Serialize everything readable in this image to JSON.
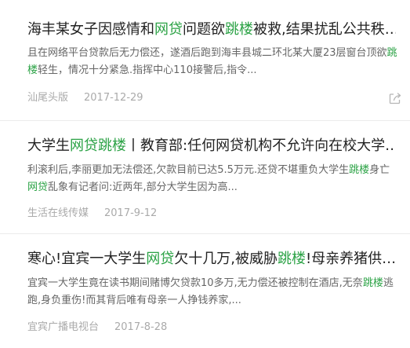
{
  "articles": [
    {
      "title": [
        {
          "t": "海丰某女子因感情和",
          "hl": false
        },
        {
          "t": "网贷",
          "hl": true
        },
        {
          "t": "问题欲",
          "hl": false
        },
        {
          "t": "跳楼",
          "hl": true
        },
        {
          "t": "被救,结果扰乱公共秩…",
          "hl": false
        }
      ],
      "summary": [
        {
          "t": "且在网络平台贷款后无力偿还，遂酒后跑到海丰县城二环北某大厦23层窗台顶欲",
          "hl": false
        },
        {
          "t": "跳楼",
          "hl": true
        },
        {
          "t": "轻生，情况十分紧急.指挥中心110接警后,指令...",
          "hl": false
        }
      ],
      "source": "汕尾头版",
      "date": "2017-12-29",
      "has_share": true
    },
    {
      "title": [
        {
          "t": "大学生",
          "hl": false
        },
        {
          "t": "网贷跳楼",
          "hl": true
        },
        {
          "t": "丨教育部:任何网贷机构不允许向在校大学…",
          "hl": false
        }
      ],
      "summary": [
        {
          "t": "利滚利后,李丽更加无法偿还,欠款目前已达5.5万元.还贷不堪重负大学生",
          "hl": false
        },
        {
          "t": "跳楼",
          "hl": true
        },
        {
          "t": "身亡",
          "hl": false
        },
        {
          "t": "网贷",
          "hl": true
        },
        {
          "t": "乱象有记者问:近两年,部分大学生因为高...",
          "hl": false
        }
      ],
      "source": "生活在线传媒",
      "date": "2017-9-12",
      "has_share": false
    },
    {
      "title": [
        {
          "t": "寒心!宜宾一大学生",
          "hl": false
        },
        {
          "t": "网贷",
          "hl": true
        },
        {
          "t": "欠十几万,被威胁",
          "hl": false
        },
        {
          "t": "跳楼",
          "hl": true
        },
        {
          "t": "!母亲养猪供…",
          "hl": false
        }
      ],
      "summary": [
        {
          "t": "宜宾一大学生竟在读书期间赌博欠贷款10多万,无力偿还被控制在酒店,无奈",
          "hl": false
        },
        {
          "t": "跳楼",
          "hl": true
        },
        {
          "t": "逃跑,身负重伤!而其背后唯有母亲一人挣钱养家,...",
          "hl": false
        }
      ],
      "source": "宜宾广播电视台",
      "date": "2017-8-28",
      "has_share": false
    }
  ],
  "colors": {
    "highlight": "#2ba245",
    "title": "#222222",
    "summary": "#666666",
    "meta": "#aaaaaa",
    "divider": "#ececec"
  },
  "icons": {
    "share": "share-icon"
  }
}
